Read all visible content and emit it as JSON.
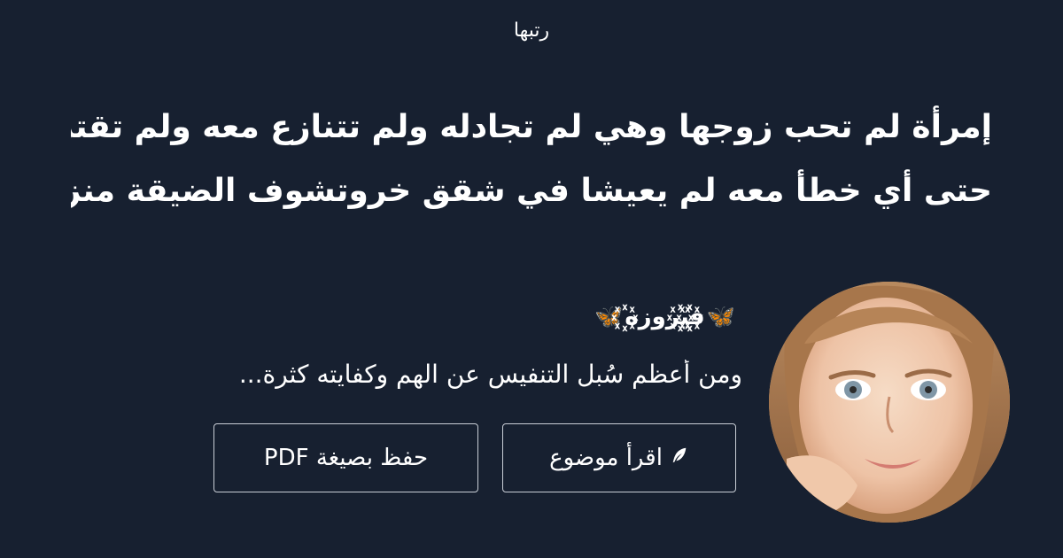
{
  "site": {
    "name": "رتبها"
  },
  "article": {
    "title_line1": "إمرأة لم تحب زوجها وهي لم تجادله ولم تتنازع معه ولم تقترف",
    "title_line2": "حتى أي خطأ معه لم يعيشا في شقق خروتشوف الضيقة منزله على",
    "author": {
      "name": "ف꙰ي꙰روزه꙰",
      "decoration_icon": "butterfly-icon",
      "decoration_color": "#62a8e8"
    },
    "excerpt": "ومن أعظم سُبل التنفيس عن الهم وكفايته كثرة..."
  },
  "actions": {
    "read_label": "اقرأ موضوع",
    "read_icon": "feather-icon",
    "pdf_label": "حفظ بصيغة PDF"
  },
  "colors": {
    "background": "#172030",
    "text": "#ffffff",
    "button_border": "#c9ced6"
  }
}
